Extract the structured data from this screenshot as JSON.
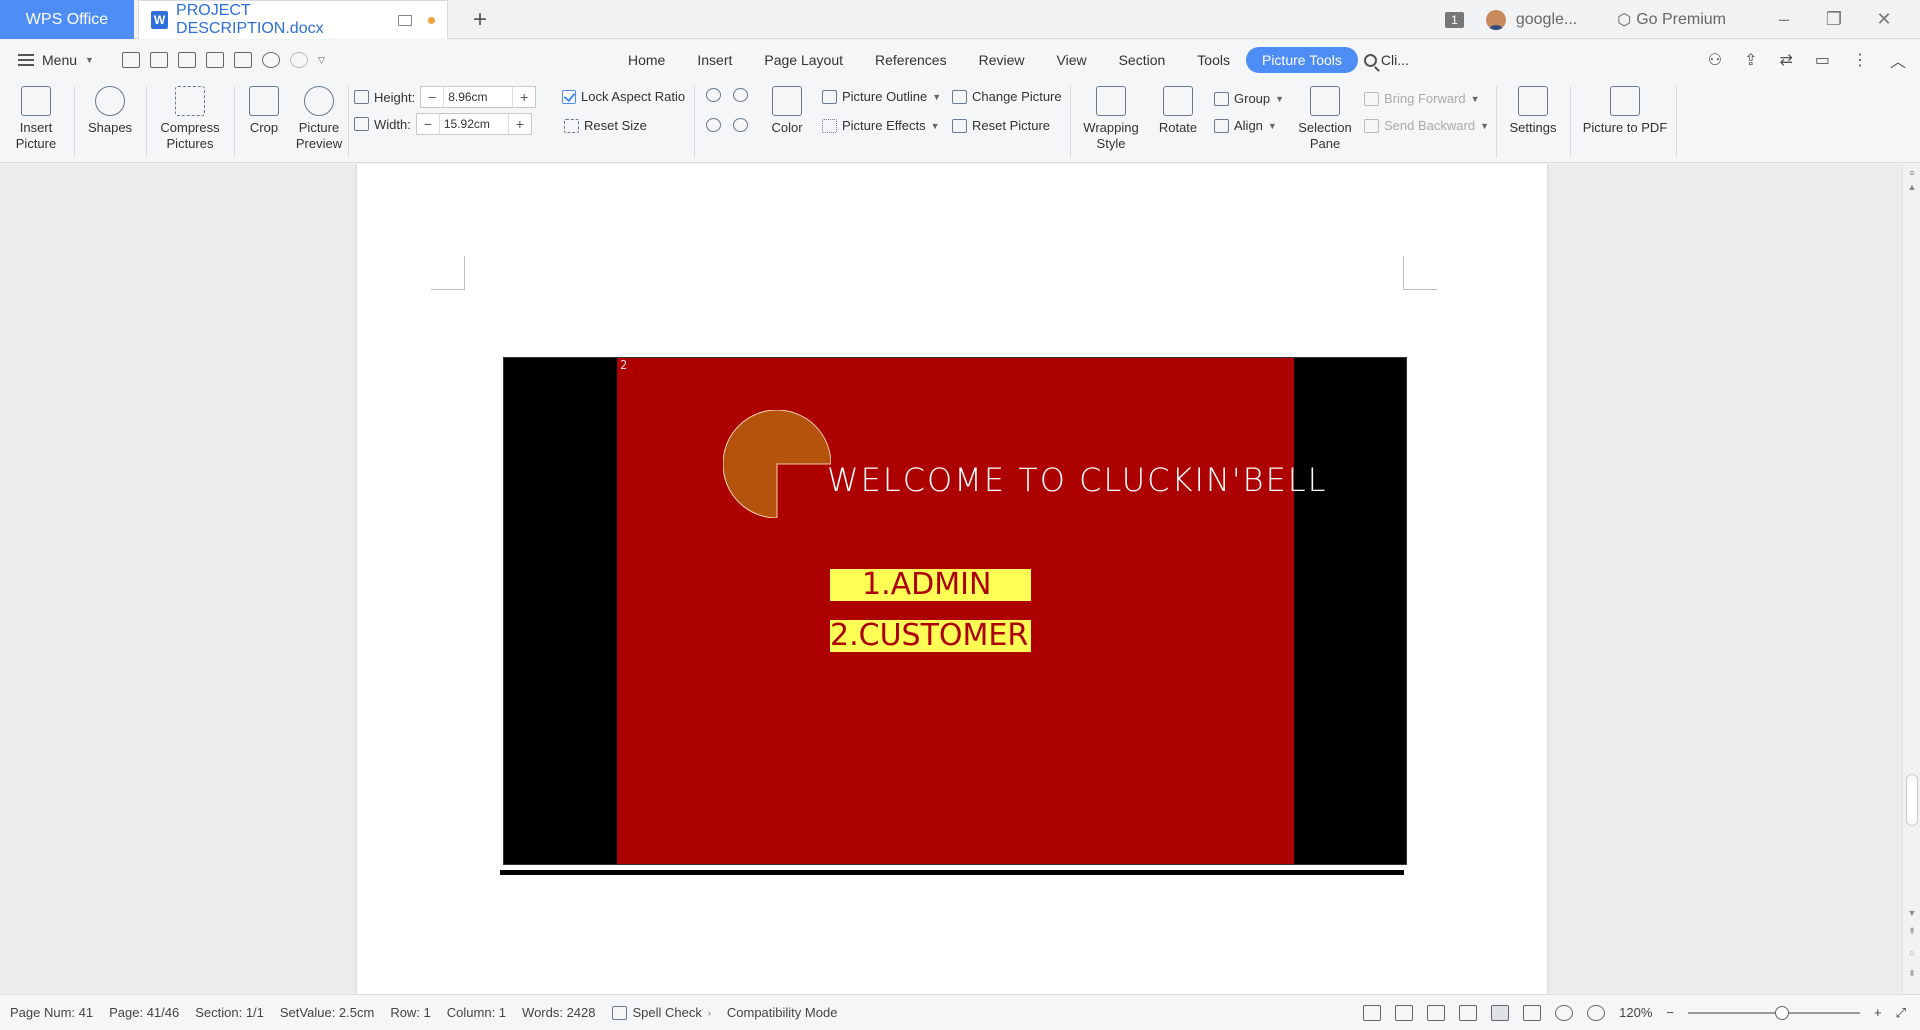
{
  "titlebar": {
    "app_tab": "WPS Office",
    "doc_tab": "PROJECT DESCRIPTION.docx",
    "new_tab_symbol": "+",
    "badge_count": "1",
    "account": "google...",
    "premium": "Go Premium"
  },
  "menu": {
    "menu_label": "Menu",
    "tabs": [
      "Home",
      "Insert",
      "Page Layout",
      "References",
      "Review",
      "View",
      "Section",
      "Tools",
      "Picture Tools"
    ],
    "active_tab": "Picture Tools",
    "search_label": "Cli..."
  },
  "ribbon": {
    "insert_picture": "Insert Picture",
    "shapes": "Shapes",
    "compress_pictures": "Compress Pictures",
    "crop": "Crop",
    "picture_preview": "Picture Preview",
    "height_label": "Height:",
    "height_value": "8.96cm",
    "width_label": "Width:",
    "width_value": "15.92cm",
    "lock_aspect_ratio": "Lock Aspect Ratio",
    "reset_size": "Reset Size",
    "color": "Color",
    "picture_outline": "Picture Outline",
    "picture_effects": "Picture Effects",
    "change_picture": "Change Picture",
    "reset_picture": "Reset Picture",
    "wrapping_style": "Wrapping Style",
    "rotate": "Rotate",
    "group": "Group",
    "align": "Align",
    "selection_pane": "Selection Pane",
    "bring_forward": "Bring Forward",
    "send_backward": "Send Backward",
    "settings": "Settings",
    "picture_to_pdf": "Picture to PDF"
  },
  "document": {
    "screen_number": "2",
    "welcome_text": "WELCOME TO CLUCKIN'BELL",
    "option_1": "1.ADMIN",
    "option_2": "2.CUSTOMER",
    "colors": {
      "screen_bg": "#ad0000",
      "pacman": "#b5520b",
      "option_bg": "#ffff55",
      "option_text": "#ad0000"
    }
  },
  "status": {
    "page_num": "Page Num: 41",
    "page": "Page: 41/46",
    "section": "Section: 1/1",
    "set_value": "SetValue: 2.5cm",
    "row": "Row: 1",
    "column": "Column: 1",
    "words": "Words: 2428",
    "spell_check": "Spell Check",
    "compat_mode": "Compatibility Mode",
    "zoom": "120%"
  }
}
